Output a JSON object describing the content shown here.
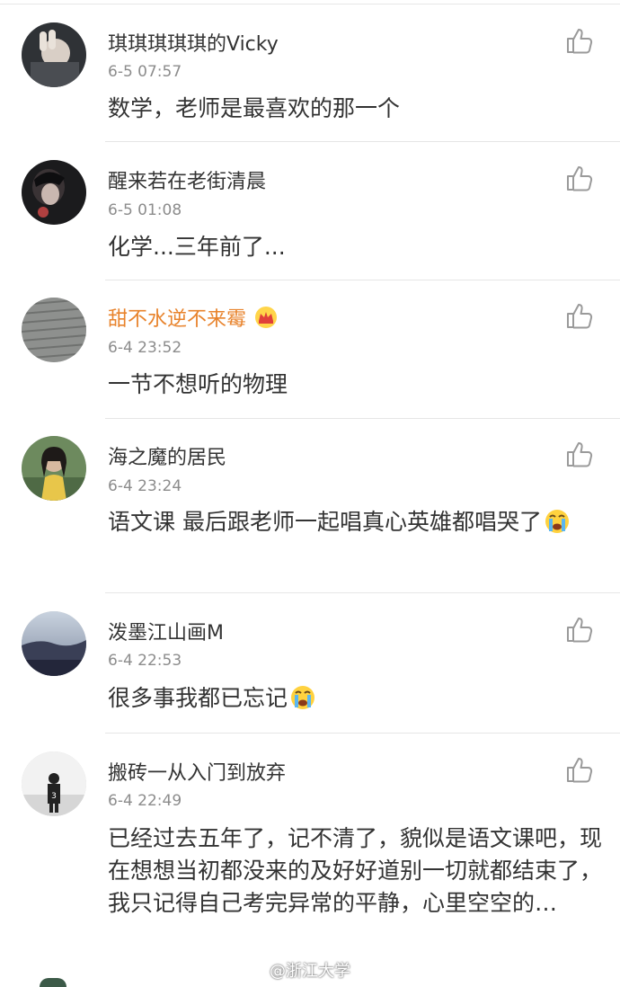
{
  "comments": [
    {
      "name": "琪琪琪琪琪的Vicky",
      "time": "6-5 07:57",
      "text": "数学，老师是最喜欢的那一个"
    },
    {
      "name": "醒来若在老街清晨",
      "time": "6-5 01:08",
      "text": "化学...三年前了..."
    },
    {
      "name": "甜不水逆不来霉",
      "time": "6-4 23:52",
      "text": "一节不想听的物理",
      "badge": "crown-icon"
    },
    {
      "name": "海之魔的居民",
      "time": "6-4 23:24",
      "text": "语文课  最后跟老师一起唱真心英雄都唱哭了",
      "emoji": "crying-emoji"
    },
    {
      "name": "泼墨江山画M",
      "time": "6-4 22:53",
      "text": "很多事我都已忘记",
      "emoji": "crying-emoji"
    },
    {
      "name": "搬砖一从入门到放弃",
      "time": "6-4 22:49",
      "text": "已经过去五年了，记不清了，貌似是语文课吧，现在想想当初都没来的及好好道别一切就都结束了，我只记得自己考完异常的平静，心里空空的…"
    }
  ],
  "watermark": "@浙江大学",
  "colors": {
    "vip_name": "#e8832c",
    "time": "#8c8c8c",
    "text": "#333333",
    "divider": "#e6e6e6"
  },
  "icons": {
    "like": "thumbs-up-icon"
  }
}
